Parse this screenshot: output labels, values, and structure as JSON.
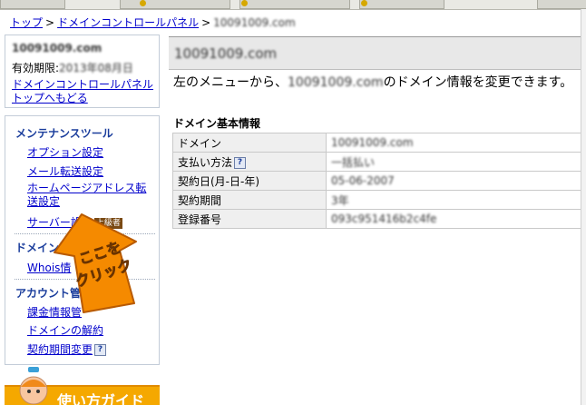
{
  "breadcrumb": {
    "top_label": "トップ",
    "panel_label": "ドメインコントロールパネル",
    "sep": ">",
    "current_domain": "10091009.com"
  },
  "sidebar": {
    "domain": "10091009.com",
    "expiry_label": "有効期限:",
    "expiry_value": "2013年08月日",
    "back_link": "ドメインコントロールパネルトップへもどる",
    "maintenance": {
      "heading": "メンテナンスツール",
      "items": [
        "オプション設定",
        "メール転送設定",
        "ホームページアドレス転送設定",
        "サーバー設定"
      ],
      "badge": "上級者"
    },
    "domain_info": {
      "heading": "ドメイン情報",
      "items": [
        "Whois情"
      ]
    },
    "account": {
      "heading": "アカウント管",
      "items": [
        "課金情報管",
        "ドメインの解約",
        "契約期間変更"
      ]
    },
    "help_glyph": "?"
  },
  "callout": {
    "line1": "ここを",
    "line2": "クリック"
  },
  "guide_banner": {
    "label": "使い方ガイド"
  },
  "main": {
    "title": "10091009.com",
    "message_prefix": "左のメニューから、",
    "message_domain": "10091009.com",
    "message_suffix": "のドメイン情報を変更できます。",
    "section_heading": "ドメイン基本情報",
    "table": [
      {
        "label": "ドメイン",
        "value": "10091009.com",
        "help": false
      },
      {
        "label": "支払い方法",
        "value": "一括払い",
        "help": true
      },
      {
        "label": "契約日(月-日-年)",
        "value": "05-06-2007",
        "help": false
      },
      {
        "label": "契約期間",
        "value": "3年",
        "help": false
      },
      {
        "label": "登録番号",
        "value": "093c951416b2c4fe",
        "help": false
      }
    ]
  },
  "colors": {
    "link": "#0000cc",
    "heading": "#1a3d9c",
    "callout_orange": "#f58a00",
    "badge_brown": "#7a4a14"
  }
}
